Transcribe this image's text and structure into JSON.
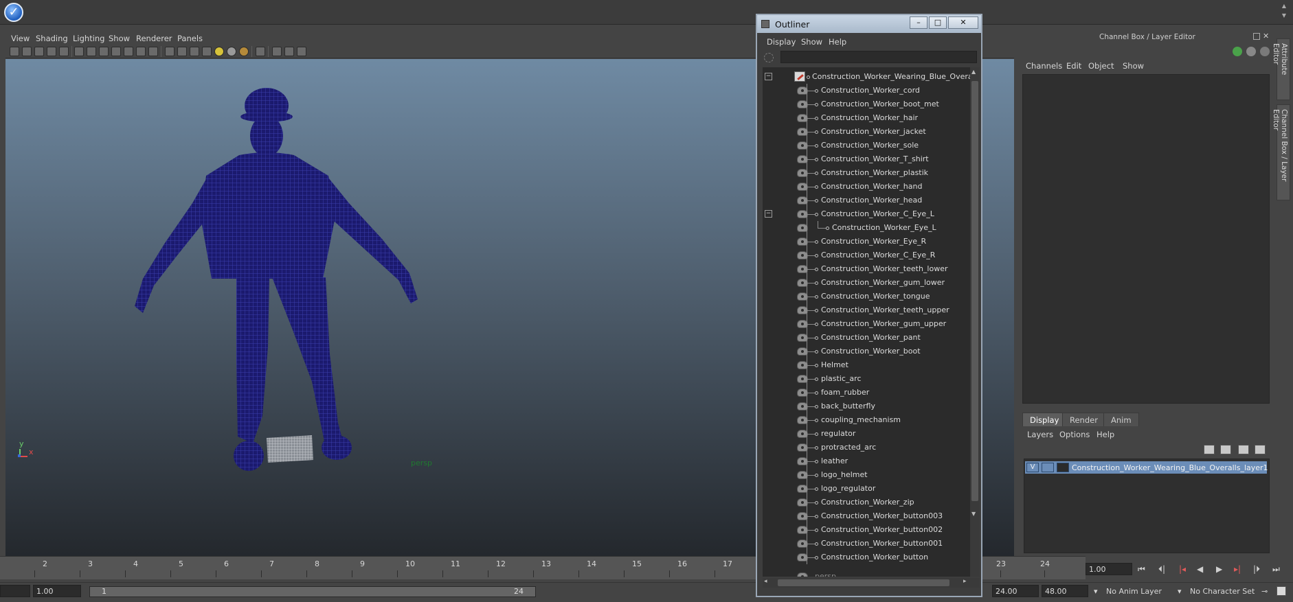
{
  "topbar": {
    "logo_icon": "maya-checkmark-icon"
  },
  "viewport": {
    "menu": [
      "View",
      "Shading",
      "Lighting",
      "Show",
      "Renderer",
      "Panels"
    ],
    "camera_label": "persp",
    "axis": {
      "y": "y",
      "x": "x"
    },
    "mesh_color": "#1c1a7a"
  },
  "timeline": {
    "ticks": [
      "2",
      "3",
      "4",
      "5",
      "6",
      "7",
      "8",
      "9",
      "10",
      "11",
      "12",
      "13",
      "14",
      "15",
      "16",
      "17",
      "23",
      "24"
    ],
    "current_frame": "1.00"
  },
  "range": {
    "start_field": "1.00",
    "slider_start": "1",
    "slider_end": "24",
    "end_time": "24.00",
    "playback_end": "48.00",
    "anim_layer": "No Anim Layer",
    "char_set": "No Character Set"
  },
  "outliner": {
    "title": "Outliner",
    "menu": [
      "Display",
      "Show",
      "Help"
    ],
    "root": "Construction_Worker_Wearing_Blue_Overalls",
    "items": [
      "Construction_Worker_cord",
      "Construction_Worker_boot_met",
      "Construction_Worker_hair",
      "Construction_Worker_jacket",
      "Construction_Worker_sole",
      "Construction_Worker_T_shirt",
      "Construction_Worker_plastik",
      "Construction_Worker_hand",
      "Construction_Worker_head",
      "Construction_Worker_C_Eye_L",
      "Construction_Worker_Eye_L",
      "Construction_Worker_Eye_R",
      "Construction_Worker_C_Eye_R",
      "Construction_Worker_teeth_lower",
      "Construction_Worker_gum_lower",
      "Construction_Worker_tongue",
      "Construction_Worker_teeth_upper",
      "Construction_Worker_gum_upper",
      "Construction_Worker_pant",
      "Construction_Worker_boot",
      "Helmet",
      "plastic_arc",
      "foam_rubber",
      "back_butterfly",
      "coupling_mechanism",
      "regulator",
      "protracted_arc",
      "leather",
      "logo_helmet",
      "logo_regulator",
      "Construction_Worker_zip",
      "Construction_Worker_button003",
      "Construction_Worker_button002",
      "Construction_Worker_button001",
      "Construction_Worker_button"
    ],
    "camera_item": "persp",
    "window_buttons": {
      "minimize": "–",
      "maximize": "□",
      "close": "✕"
    }
  },
  "right_panel": {
    "title": "Channel Box / Layer Editor",
    "channel_menu": [
      "Channels",
      "Edit",
      "Object",
      "Show"
    ],
    "tabs": [
      "Display",
      "Render",
      "Anim"
    ],
    "active_tab": "Display",
    "layer_menu": [
      "Layers",
      "Options",
      "Help"
    ],
    "layer": {
      "visible": "V",
      "name": "Construction_Worker_Wearing_Blue_Overalls_layer1"
    },
    "side_tabs": [
      "Attribute Editor",
      "Channel Box / Layer Editor"
    ]
  }
}
